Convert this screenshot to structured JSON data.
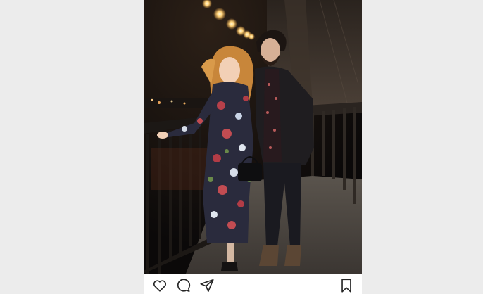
{
  "post": {
    "photo_alt": "",
    "actions": {
      "like_icon": "heart-outline",
      "comment_icon": "speech-bubble-outline",
      "share_icon": "paper-plane-outline",
      "save_icon": "bookmark-outline"
    }
  },
  "colors": {
    "page_background": "#ececec",
    "card_background": "#ffffff",
    "icon_stroke": "#262626"
  }
}
